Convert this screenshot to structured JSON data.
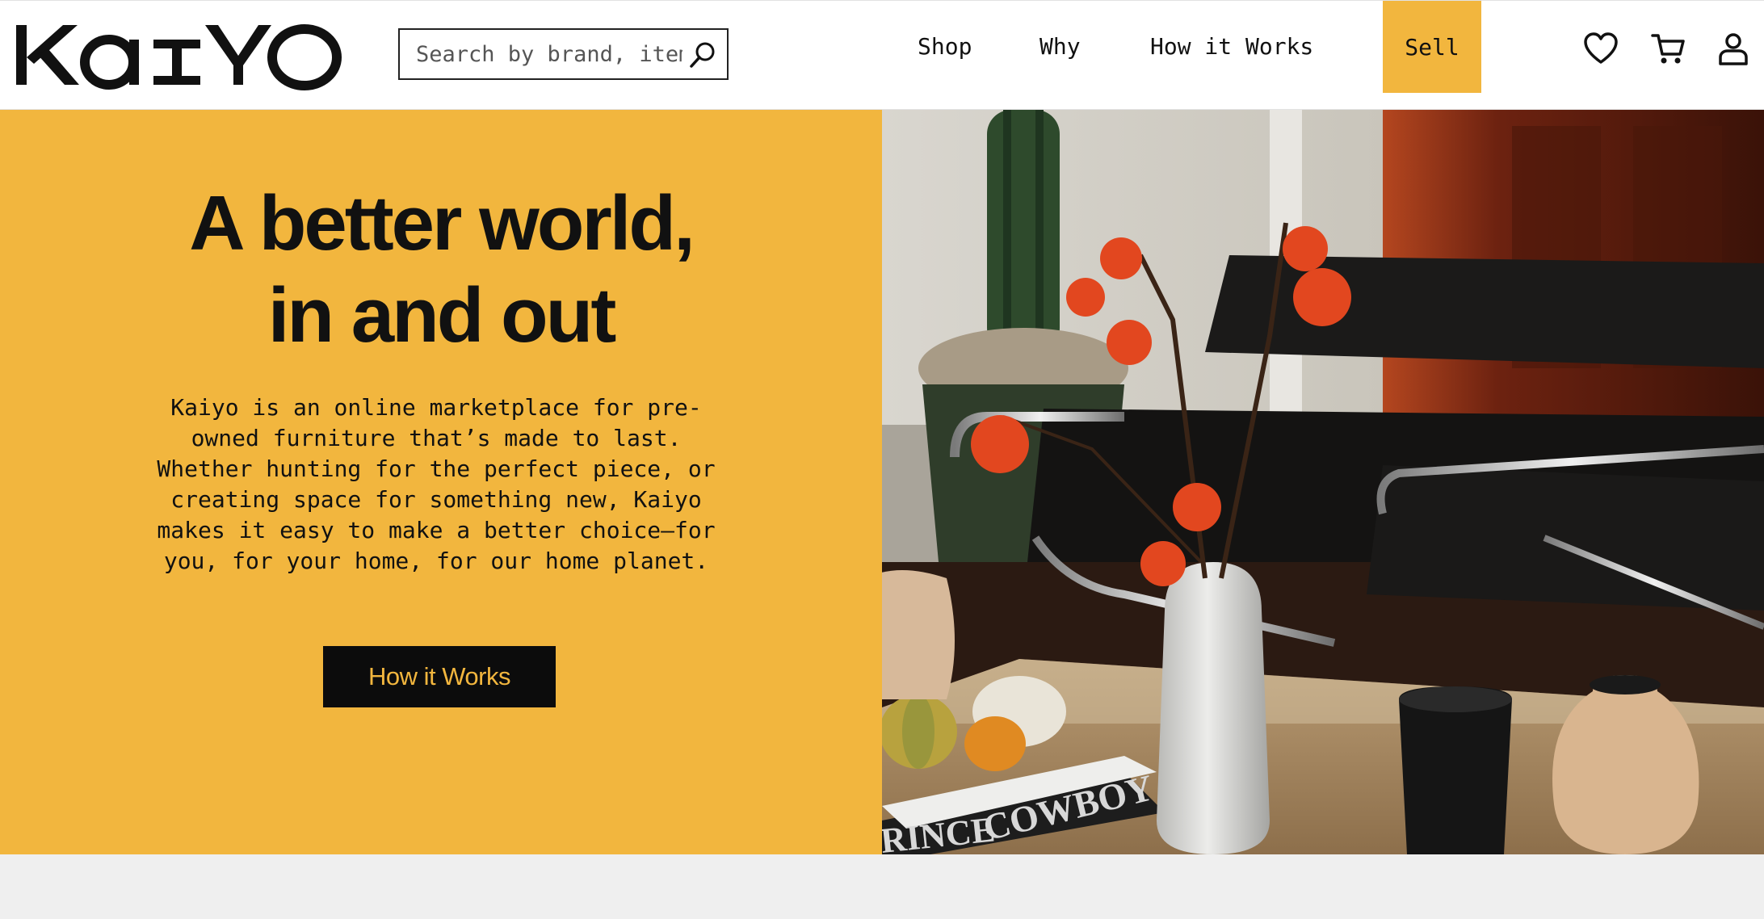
{
  "brand": {
    "name": "KAIYO"
  },
  "search": {
    "placeholder": "Search by brand, item"
  },
  "nav": {
    "items": [
      {
        "label": "Shop"
      },
      {
        "label": "Why"
      },
      {
        "label": "How it Works"
      }
    ],
    "sell_label": "Sell"
  },
  "header_icons": [
    "heart-icon",
    "cart-icon",
    "account-icon"
  ],
  "hero": {
    "title_line1": "A better world,",
    "title_line2": "in and out",
    "body": "Kaiyo is an online marketplace for pre-owned furniture that’s made to last. Whether hunting for the perfect piece, or creating space for something new, Kaiyo makes it easy to make a better choice—for you, for your home, for our home planet.",
    "button_label": "How it Works"
  },
  "colors": {
    "accent": "#f2b63e",
    "dark": "#0c0c0c",
    "background": "#ffffff",
    "footer_bg": "#efefef"
  }
}
